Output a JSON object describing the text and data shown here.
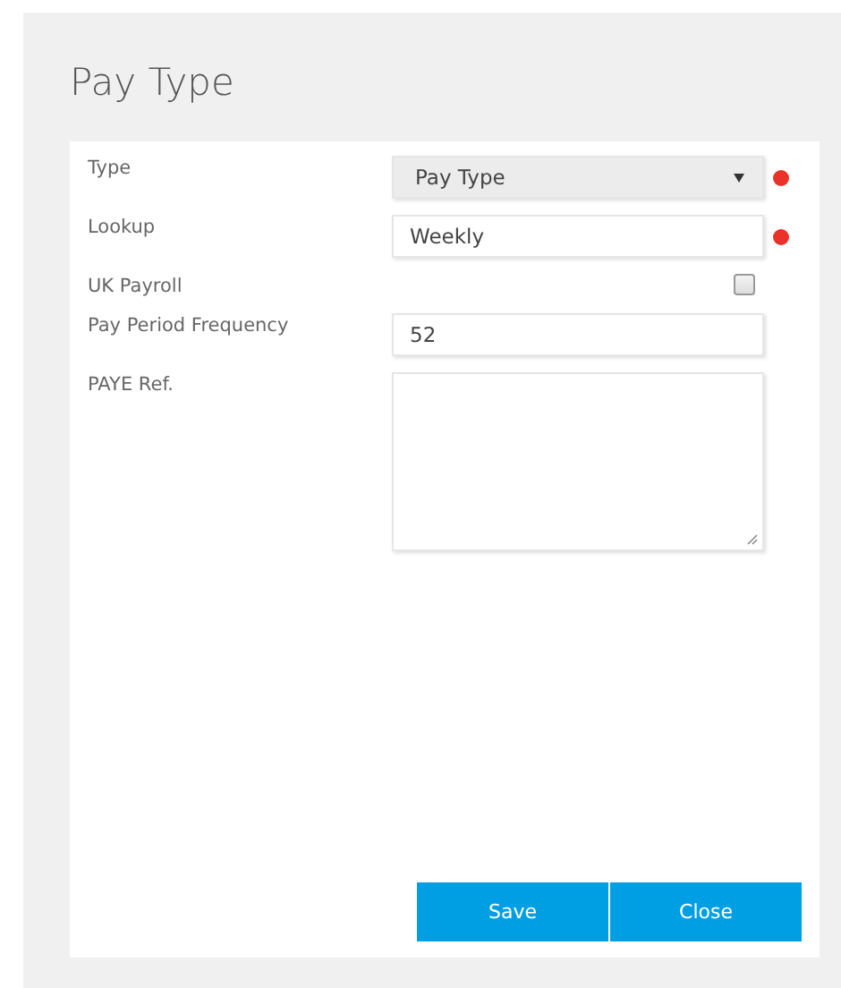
{
  "title": "Pay Type",
  "fields": [
    {
      "kind": "select",
      "label": "Type",
      "value": "Pay Type",
      "required": true
    },
    {
      "kind": "text",
      "label": "Lookup",
      "value": "Weekly",
      "required": true
    },
    {
      "kind": "checkbox",
      "label": "UK Payroll",
      "checked": false,
      "required": false
    },
    {
      "kind": "text",
      "label": "Pay Period Frequency",
      "value": "52",
      "required": false
    },
    {
      "kind": "textarea",
      "label": "PAYE Ref.",
      "required": false
    }
  ],
  "buttons": [
    "Save",
    "Close"
  ]
}
